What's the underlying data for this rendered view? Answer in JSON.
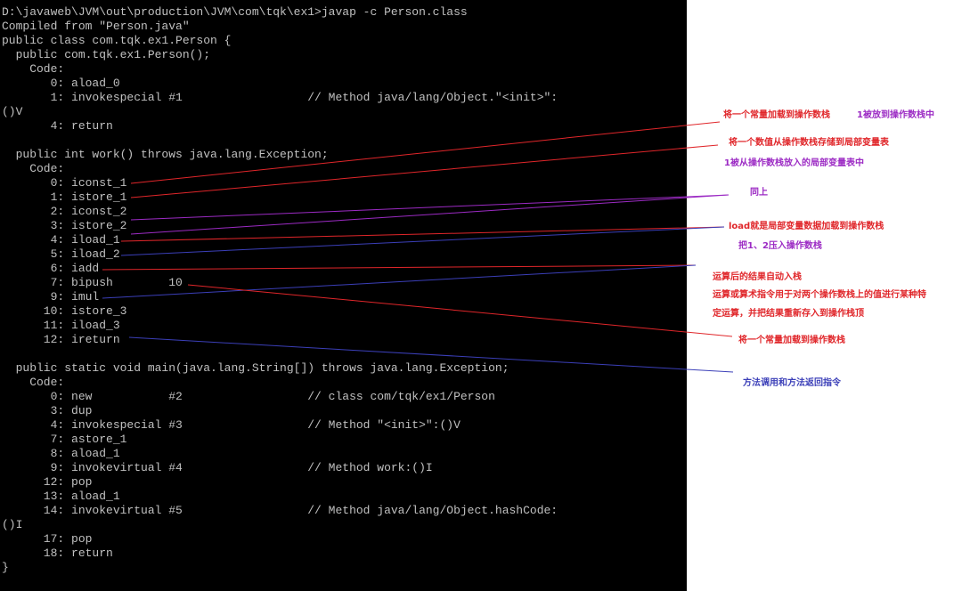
{
  "console": {
    "lines": [
      "D:\\javaweb\\JVM\\out\\production\\JVM\\com\\tqk\\ex1>javap -c Person.class",
      "Compiled from \"Person.java\"",
      "public class com.tqk.ex1.Person {",
      "  public com.tqk.ex1.Person();",
      "    Code:",
      "       0: aload_0",
      "       1: invokespecial #1                  // Method java/lang/Object.\"<init>\":",
      "()V",
      "       4: return",
      "",
      "  public int work() throws java.lang.Exception;",
      "    Code:",
      "       0: iconst_1",
      "       1: istore_1",
      "       2: iconst_2",
      "       3: istore_2",
      "       4: iload_1",
      "       5: iload_2",
      "       6: iadd",
      "       7: bipush        10",
      "       9: imul",
      "      10: istore_3",
      "      11: iload_3",
      "      12: ireturn",
      "",
      "  public static void main(java.lang.String[]) throws java.lang.Exception;",
      "    Code:",
      "       0: new           #2                  // class com/tqk/ex1/Person",
      "       3: dup",
      "       4: invokespecial #3                  // Method \"<init>\":()V",
      "       7: astore_1",
      "       8: aload_1",
      "       9: invokevirtual #4                  // Method work:()I",
      "      12: pop",
      "      13: aload_1",
      "      14: invokevirtual #5                  // Method java/lang/Object.hashCode:",
      "()I",
      "      17: pop",
      "      18: return",
      "}"
    ]
  },
  "annotations": {
    "const_load": "将一个常量加载到操作数栈",
    "pushed_1": "1被放到操作数栈中",
    "store_local": "将一个数值从操作数栈存储到局部变量表",
    "popped_1": "1被从操作数栈放入的局部变量表中",
    "same": "同上",
    "load_desc": "load就是局部变量数据加载到操作数栈",
    "push_12": "把1、2压入操作数栈",
    "auto_push": "运算后的结果自动入栈",
    "arith_desc_1": "运算或算术指令用于对两个操作数栈上的值进行某种特",
    "arith_desc_2": "定运算，并把结果重新存入到操作栈顶",
    "const_load_2": "将一个常量加载到操作数栈",
    "invoke_return": "方法调用和方法返回指令"
  },
  "colors": {
    "console_bg": "#000000",
    "console_text": "#c0c0c0",
    "annotation_red": "#e0262a",
    "annotation_purple": "#9c2bc4",
    "annotation_blue": "#3b3fb8"
  }
}
